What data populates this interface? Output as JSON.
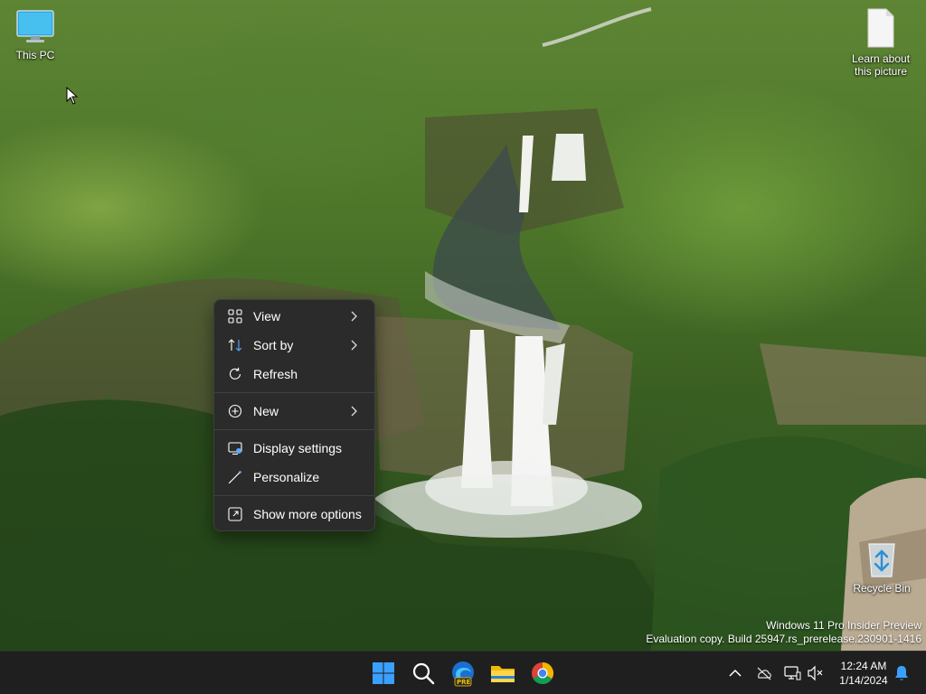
{
  "desktop": {
    "icons": [
      {
        "label": "This PC"
      },
      {
        "label": "Learn about this picture"
      },
      {
        "label": "Recycle Bin"
      }
    ]
  },
  "context_menu": {
    "items": [
      {
        "label": "View",
        "icon": "grid-icon",
        "has_submenu": true
      },
      {
        "label": "Sort by",
        "icon": "sort-icon",
        "has_submenu": true
      },
      {
        "label": "Refresh",
        "icon": "refresh-icon",
        "has_submenu": false
      },
      {
        "label": "New",
        "icon": "plus-circle-icon",
        "has_submenu": true
      },
      {
        "label": "Display settings",
        "icon": "display-icon",
        "has_submenu": false
      },
      {
        "label": "Personalize",
        "icon": "brush-icon",
        "has_submenu": false
      },
      {
        "label": "Show more options",
        "icon": "open-external-icon",
        "has_submenu": false
      }
    ]
  },
  "watermark": {
    "line1": "Windows 11 Pro Insider Preview",
    "line2": "Evaluation copy. Build 25947.rs_prerelease.230901-1416"
  },
  "taskbar": {
    "apps": [
      {
        "name": "start",
        "icon": "windows-logo-icon"
      },
      {
        "name": "search",
        "icon": "search-icon"
      },
      {
        "name": "edge-preview",
        "icon": "edge-icon",
        "badge": "PRE"
      },
      {
        "name": "file-explorer",
        "icon": "folder-icon"
      },
      {
        "name": "chrome",
        "icon": "chrome-icon"
      }
    ],
    "tray": {
      "icons": [
        "chevron-up-icon",
        "onedrive-offline-icon",
        "network-icon",
        "volume-muted-icon",
        "notification-bell-icon"
      ]
    },
    "clock": {
      "time": "12:24 AM",
      "date": "1/14/2024"
    }
  },
  "colors": {
    "menu_bg": "#2b2b2b",
    "taskbar_bg": "#1f1f1f",
    "accent_blue": "#0078d4",
    "bell_blue": "#3aa0ff"
  }
}
